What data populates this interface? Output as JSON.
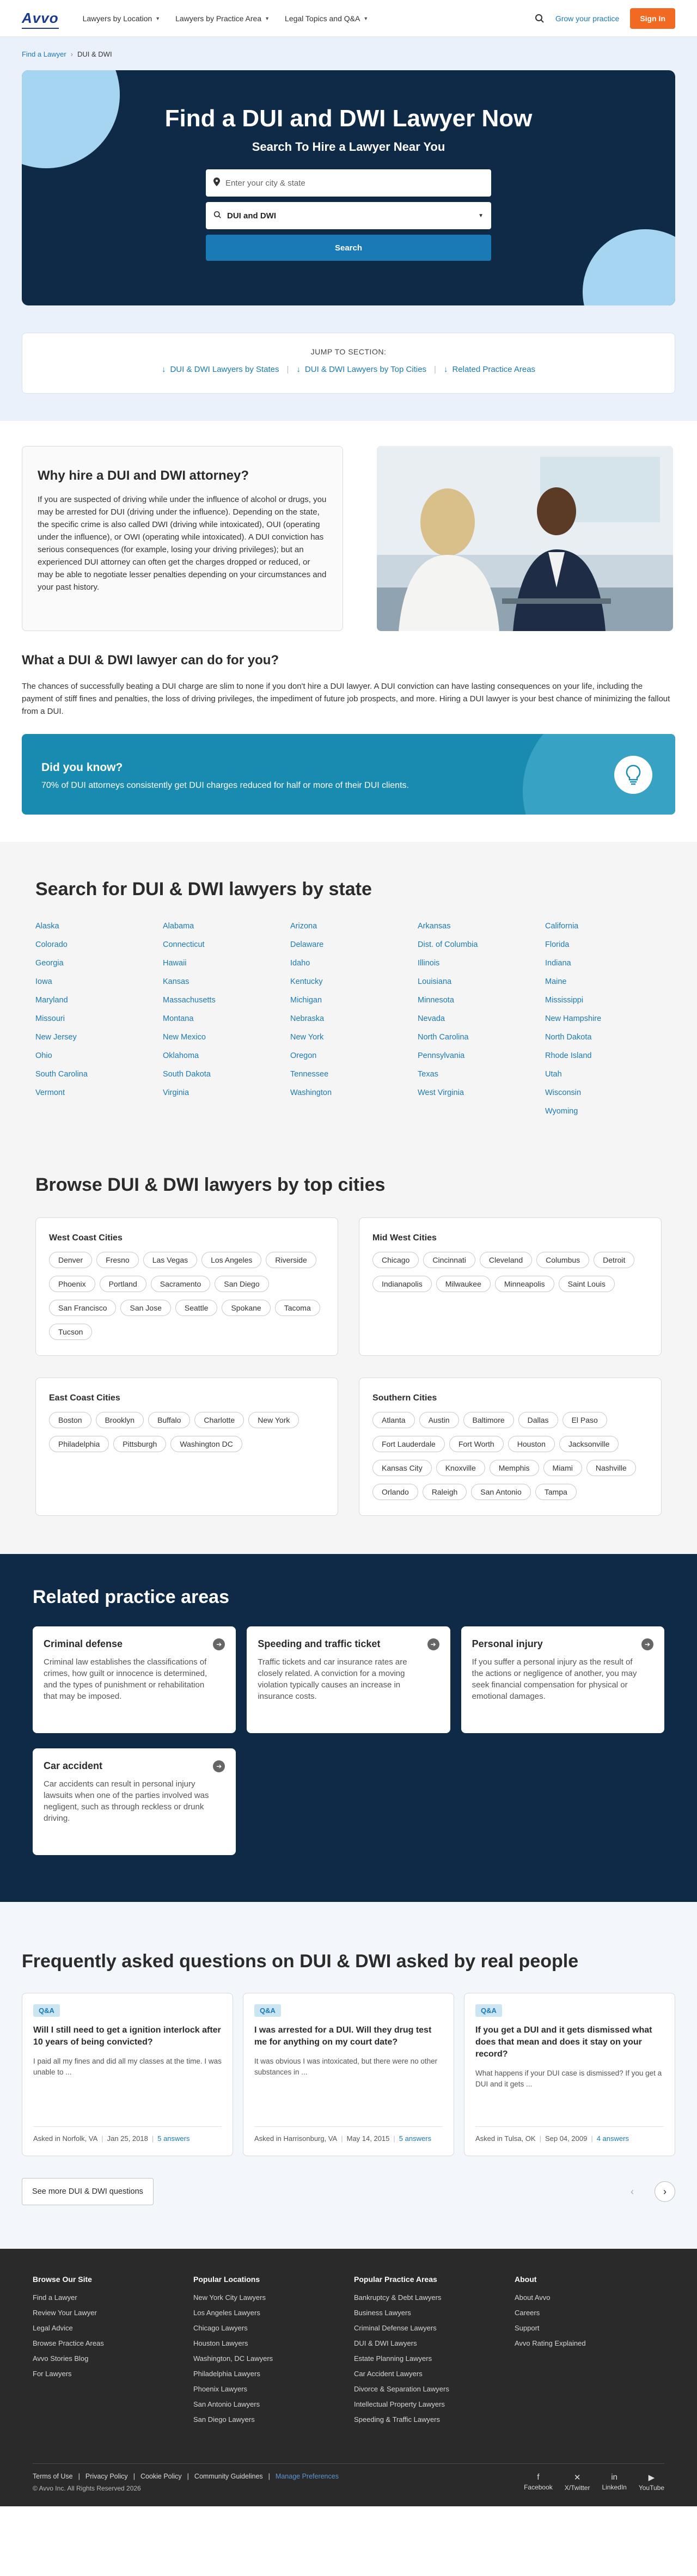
{
  "header": {
    "logo": "Avvo",
    "nav": [
      "Lawyers by Location",
      "Lawyers by Practice Area",
      "Legal Topics and Q&A"
    ],
    "grow": "Grow your practice",
    "signin": "Sign In"
  },
  "breadcrumb": [
    "Find a Lawyer",
    "DUI & DWI"
  ],
  "hero": {
    "title": "Find a DUI and DWI Lawyer Now",
    "subtitle": "Search To Hire a Lawyer Near You",
    "location_placeholder": "Enter your city & state",
    "practice_value": "DUI and DWI",
    "search": "Search"
  },
  "jump": {
    "title": "JUMP TO SECTION:",
    "links": [
      "DUI & DWI Lawyers by States",
      "DUI & DWI Lawyers by Top Cities",
      "Related Practice Areas"
    ]
  },
  "why": {
    "title": "Why hire a DUI and DWI attorney?",
    "body": "If you are suspected of driving while under the influence of alcohol or drugs, you may be arrested for DUI (driving under the influence). Depending on the state, the specific crime is also called DWI (driving while intoxicated), OUI (operating under the influence), or OWI (operating while intoxicated). A DUI conviction has serious consequences (for example, losing your driving privileges); but an experienced DUI attorney can often get the charges dropped or reduced, or may be able to negotiate lesser penalties depending on your circumstances and your past history."
  },
  "what": {
    "title": "What a DUI & DWI lawyer can do for you?",
    "body": "The chances of successfully beating a DUI charge are slim to none if you don't hire a DUI lawyer. A DUI conviction can have lasting consequences on your life, including the payment of stiff fines and penalties, the loss of driving privileges, the impediment of future job prospects, and more. Hiring a DUI lawyer is your best chance of minimizing the fallout from a DUI."
  },
  "dyk": {
    "title": "Did you know?",
    "body": "70% of DUI attorneys consistently get DUI charges reduced for half or more of their DUI clients."
  },
  "states": {
    "title": "Search for DUI & DWI lawyers by state",
    "items": [
      "Alaska",
      "Alabama",
      "Arizona",
      "Arkansas",
      "California",
      "Colorado",
      "Connecticut",
      "Delaware",
      "Dist. of Columbia",
      "Florida",
      "Georgia",
      "Hawaii",
      "Idaho",
      "Illinois",
      "Indiana",
      "Iowa",
      "Kansas",
      "Kentucky",
      "Louisiana",
      "Maine",
      "Maryland",
      "Massachusetts",
      "Michigan",
      "Minnesota",
      "Mississippi",
      "Missouri",
      "Montana",
      "Nebraska",
      "Nevada",
      "New Hampshire",
      "New Jersey",
      "New Mexico",
      "New York",
      "North Carolina",
      "North Dakota",
      "Ohio",
      "Oklahoma",
      "Oregon",
      "Pennsylvania",
      "Rhode Island",
      "South Carolina",
      "South Dakota",
      "Tennessee",
      "Texas",
      "Utah",
      "Vermont",
      "Virginia",
      "Washington",
      "West Virginia",
      "Wisconsin",
      "",
      "",
      "",
      "",
      "Wyoming"
    ]
  },
  "cities": {
    "title": "Browse DUI & DWI lawyers by top cities",
    "groups": [
      {
        "name": "West Coast Cities",
        "items": [
          "Denver",
          "Fresno",
          "Las Vegas",
          "Los Angeles",
          "Riverside",
          "Phoenix",
          "Portland",
          "Sacramento",
          "San Diego",
          "San Francisco",
          "San Jose",
          "Seattle",
          "Spokane",
          "Tacoma",
          "Tucson"
        ]
      },
      {
        "name": "Mid West Cities",
        "items": [
          "Chicago",
          "Cincinnati",
          "Cleveland",
          "Columbus",
          "Detroit",
          "Indianapolis",
          "Milwaukee",
          "Minneapolis",
          "Saint Louis"
        ]
      },
      {
        "name": "East Coast Cities",
        "items": [
          "Boston",
          "Brooklyn",
          "Buffalo",
          "Charlotte",
          "New York",
          "Philadelphia",
          "Pittsburgh",
          "Washington DC"
        ]
      },
      {
        "name": "Southern Cities",
        "items": [
          "Atlanta",
          "Austin",
          "Baltimore",
          "Dallas",
          "El Paso",
          "Fort Lauderdale",
          "Fort Worth",
          "Houston",
          "Jacksonville",
          "Kansas City",
          "Knoxville",
          "Memphis",
          "Miami",
          "Nashville",
          "Orlando",
          "Raleigh",
          "San Antonio",
          "Tampa"
        ]
      }
    ]
  },
  "practice": {
    "title": "Related practice areas",
    "cards": [
      {
        "title": "Criminal defense",
        "body": "Criminal law establishes the classifications of crimes, how guilt or innocence is determined, and the types of punishment or rehabilitation that may be imposed."
      },
      {
        "title": "Speeding and traffic ticket",
        "body": "Traffic tickets and car insurance rates are closely related. A conviction for a moving violation typically causes an increase in insurance costs."
      },
      {
        "title": "Personal injury",
        "body": "If you suffer a personal injury as the result of the actions or negligence of another, you may seek financial compensation for physical or emotional damages."
      },
      {
        "title": "Car accident",
        "body": "Car accidents can result in personal injury lawsuits when one of the parties involved was negligent, such as through reckless or drunk driving."
      }
    ]
  },
  "faq": {
    "title": "Frequently asked questions on DUI & DWI asked by real people",
    "badge": "Q&A",
    "cards": [
      {
        "q": "Will I still need to get a ignition interlock after 10 years of being convicted?",
        "a": "I paid all my fines and did all my classes at the time. I was unable to ...",
        "loc": "Asked in Norfolk, VA",
        "date": "Jan 25, 2018",
        "answers": "5 answers"
      },
      {
        "q": "I was arrested for a DUI. Will they drug test me for anything on my court date?",
        "a": "It was obvious I was intoxicated, but there were no other substances in ...",
        "loc": "Asked in Harrisonburg, VA",
        "date": "May 14, 2015",
        "answers": "5 answers"
      },
      {
        "q": "If you get a DUI and it gets dismissed what does that mean and does it stay on your record?",
        "a": "What happens if your DUI case is dismissed? If you get a DUI and it gets ...",
        "loc": "Asked in Tulsa, OK",
        "date": "Sep 04, 2009",
        "answers": "4 answers"
      }
    ],
    "see_more": "See more DUI & DWI questions"
  },
  "footer": {
    "cols": [
      {
        "title": "Browse Our Site",
        "links": [
          "Find a Lawyer",
          "Review Your Lawyer",
          "Legal Advice",
          "Browse Practice Areas",
          "Avvo Stories Blog",
          "For Lawyers"
        ]
      },
      {
        "title": "Popular Locations",
        "links": [
          "New York City Lawyers",
          "Los Angeles Lawyers",
          "Chicago Lawyers",
          "Houston Lawyers",
          "Washington, DC Lawyers",
          "Philadelphia Lawyers",
          "Phoenix Lawyers",
          "San Antonio Lawyers",
          "San Diego Lawyers"
        ]
      },
      {
        "title": "Popular Practice Areas",
        "links": [
          "Bankruptcy & Debt Lawyers",
          "Business Lawyers",
          "Criminal Defense Lawyers",
          "DUI & DWI Lawyers",
          "Estate Planning Lawyers",
          "Car Accident Lawyers",
          "Divorce & Separation Lawyers",
          "Intellectual Property Lawyers",
          "Speeding & Traffic Lawyers"
        ]
      },
      {
        "title": "About",
        "links": [
          "About Avvo",
          "Careers",
          "Support",
          "Avvo Rating Explained"
        ]
      }
    ],
    "legal": [
      "Terms of Use",
      "Privacy Policy",
      "Cookie Policy",
      "Community Guidelines",
      "Manage Preferences"
    ],
    "copyright": "© Avvo Inc. All Rights Reserved 2026",
    "social": [
      "Facebook",
      "X/Twitter",
      "LinkedIn",
      "YouTube"
    ]
  },
  "colors": {
    "navy": "#0e2a47",
    "blue": "#1a7ab5",
    "orange": "#f26a21",
    "teal": "#1a8bb0"
  }
}
